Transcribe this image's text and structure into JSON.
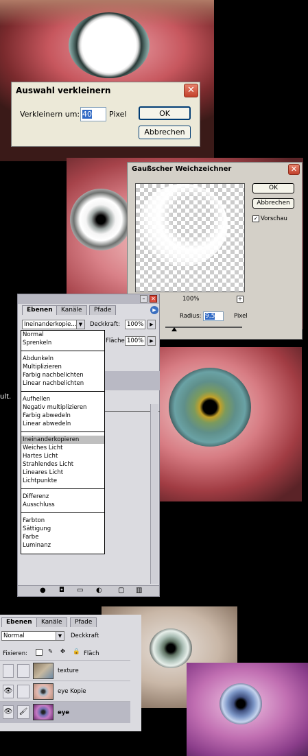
{
  "dialog_shrink": {
    "title": "Auswahl verkleinern",
    "label": "Verkleinern um:",
    "value": "40",
    "unit": "Pixel",
    "ok": "OK",
    "cancel": "Abbrechen"
  },
  "dialog_blur": {
    "title": "Gaußscher Weichzeichner",
    "ok": "OK",
    "cancel": "Abbrechen",
    "preview_label": "Vorschau",
    "zoom": "100%",
    "radius_label": "Radius:",
    "radius_value": "9,5",
    "radius_unit": "Pixel"
  },
  "layers_panel_top": {
    "tabs": [
      "Ebenen",
      "Kanäle",
      "Pfade"
    ],
    "blend_mode": "Ineinanderkopie...",
    "opacity_label": "Deckkraft:",
    "opacity_value": "100%",
    "fill_label": "Fläche",
    "fill_value": "100%",
    "blend_menu": {
      "groups": [
        [
          "Normal",
          "Sprenkeln"
        ],
        [
          "Abdunkeln",
          "Multiplizieren",
          "Farbig nachbelichten",
          "Linear nachbelichten"
        ],
        [
          "Aufhellen",
          "Negativ multiplizieren",
          "Farbig abwedeln",
          "Linear abwedeln"
        ],
        [
          "Ineinanderkopieren",
          "Weiches Licht",
          "Hartes Licht",
          "Strahlendes Licht",
          "Lineares Licht",
          "Lichtpunkte"
        ],
        [
          "Differenz",
          "Ausschluss"
        ],
        [
          "Farbton",
          "Sättigung",
          "Farbe",
          "Luminanz"
        ]
      ],
      "selected": "Ineinanderkopieren"
    }
  },
  "side_text": "ult.",
  "layers_panel_bottom": {
    "tabs": [
      "Ebenen",
      "Kanäle",
      "Pfade"
    ],
    "blend_mode": "Normal",
    "opacity_label": "Deckkraft",
    "lock_label": "Fixieren:",
    "fill_label": "Fläch",
    "layers": [
      {
        "name": "texture",
        "visible": false,
        "active": false
      },
      {
        "name": "eye Kopie",
        "visible": true,
        "active": false
      },
      {
        "name": "eye",
        "visible": true,
        "active": true
      }
    ]
  },
  "colors": {
    "xp_close": "#c2412b",
    "panel_bg": "#dbdbe0",
    "selected_layer": "#b9b9c4"
  }
}
